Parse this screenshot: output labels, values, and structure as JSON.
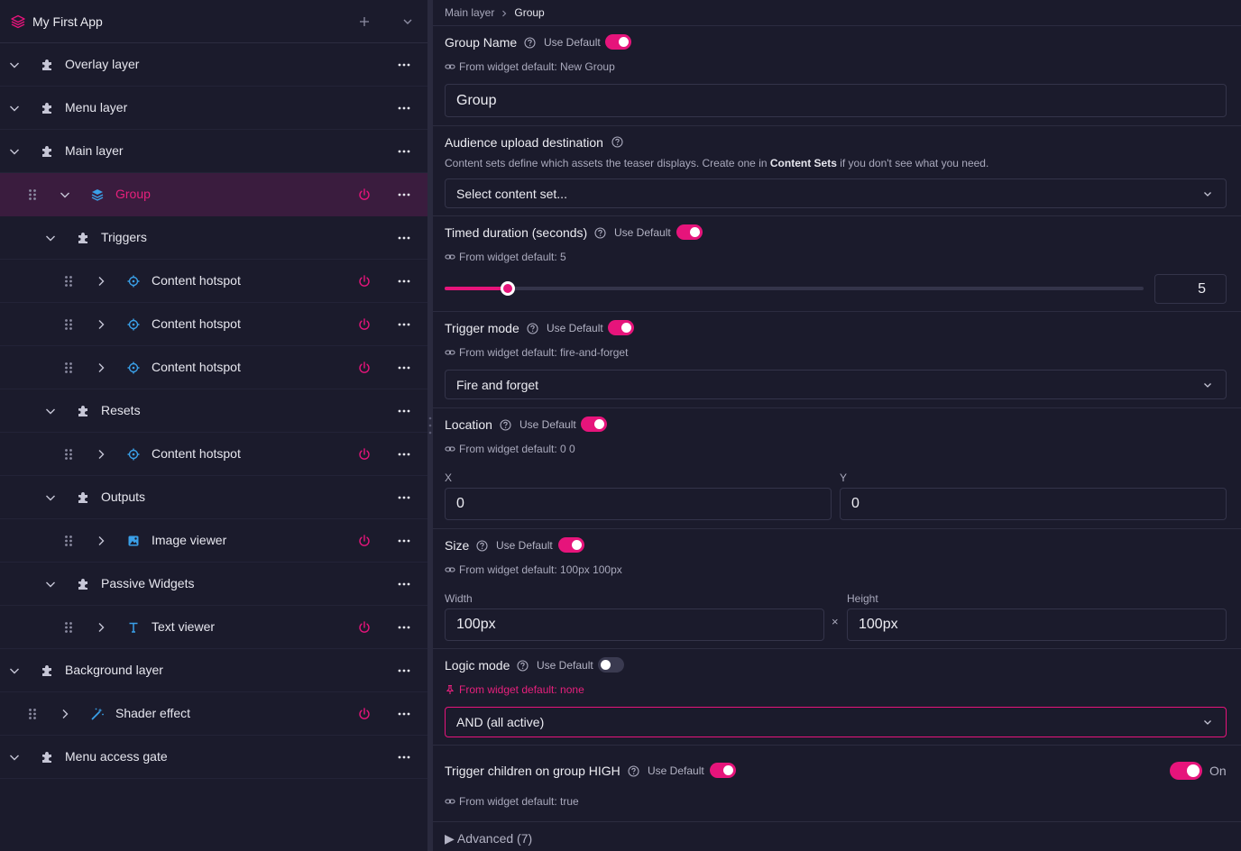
{
  "app": {
    "title": "My First App"
  },
  "tree": [
    {
      "label": "Overlay layer",
      "icon": "puzzle-icon",
      "level": 0,
      "expanded": true,
      "grip": false,
      "power": false
    },
    {
      "label": "Menu layer",
      "icon": "puzzle-icon",
      "level": 0,
      "expanded": true,
      "grip": false,
      "power": false
    },
    {
      "label": "Main layer",
      "icon": "puzzle-icon",
      "level": 0,
      "expanded": true,
      "grip": false,
      "power": false
    },
    {
      "label": "Group",
      "icon": "layers-icon",
      "level": 1,
      "expanded": true,
      "grip": true,
      "power": true,
      "selected": true
    },
    {
      "label": "Triggers",
      "icon": "puzzle-icon",
      "level": 2,
      "expanded": true,
      "grip": false,
      "power": false
    },
    {
      "label": "Content hotspot",
      "icon": "crosshair-icon",
      "level": 3,
      "expanded": false,
      "grip": true,
      "power": true
    },
    {
      "label": "Content hotspot",
      "icon": "crosshair-icon",
      "level": 3,
      "expanded": false,
      "grip": true,
      "power": true
    },
    {
      "label": "Content hotspot",
      "icon": "crosshair-icon",
      "level": 3,
      "expanded": false,
      "grip": true,
      "power": true
    },
    {
      "label": "Resets",
      "icon": "puzzle-icon",
      "level": 2,
      "expanded": true,
      "grip": false,
      "power": false
    },
    {
      "label": "Content hotspot",
      "icon": "crosshair-icon",
      "level": 3,
      "expanded": false,
      "grip": true,
      "power": true
    },
    {
      "label": "Outputs",
      "icon": "puzzle-icon",
      "level": 2,
      "expanded": true,
      "grip": false,
      "power": false
    },
    {
      "label": "Image viewer",
      "icon": "image-icon",
      "level": 3,
      "expanded": false,
      "grip": true,
      "power": true
    },
    {
      "label": "Passive Widgets",
      "icon": "puzzle-icon",
      "level": 2,
      "expanded": true,
      "grip": false,
      "power": false
    },
    {
      "label": "Text viewer",
      "icon": "text-icon",
      "level": 3,
      "expanded": false,
      "grip": true,
      "power": true
    },
    {
      "label": "Background layer",
      "icon": "puzzle-icon",
      "level": 0,
      "expanded": true,
      "grip": false,
      "power": false
    },
    {
      "label": "Shader effect",
      "icon": "magic-wand-icon",
      "level": 1,
      "expanded": false,
      "grip": true,
      "power": true
    },
    {
      "label": "Menu access gate",
      "icon": "puzzle-icon",
      "level": 0,
      "expanded": true,
      "grip": false,
      "power": false
    }
  ],
  "breadcrumb": {
    "parent": "Main layer",
    "current": "Group"
  },
  "props": {
    "use_default_label": "Use Default",
    "group_name": {
      "title": "Group Name",
      "use_default": true,
      "from_default": "From widget default: New Group",
      "value": "Group"
    },
    "audience": {
      "title": "Audience upload destination",
      "desc_before": "Content sets define which assets the teaser displays. Create one in ",
      "desc_link": "Content Sets",
      "desc_after": " if you don't see what you need.",
      "placeholder": "Select content set..."
    },
    "timed": {
      "title": "Timed duration (seconds)",
      "use_default": true,
      "from_default": "From widget default: 5",
      "value": "5",
      "slider_fraction": 0.09
    },
    "trigger_mode": {
      "title": "Trigger mode",
      "use_default": true,
      "from_default": "From widget default: fire-and-forget",
      "value": "Fire and forget"
    },
    "location": {
      "title": "Location",
      "use_default": true,
      "from_default": "From widget default: 0 0",
      "x_label": "X",
      "x_value": "0",
      "y_label": "Y",
      "y_value": "0"
    },
    "size": {
      "title": "Size",
      "use_default": true,
      "from_default": "From widget default: 100px 100px",
      "width_label": "Width",
      "width_value": "100px",
      "times": "×",
      "height_label": "Height",
      "height_value": "100px"
    },
    "logic_mode": {
      "title": "Logic mode",
      "use_default": false,
      "from_default": "From widget default: none",
      "value": "AND (all active)"
    },
    "trigger_children": {
      "title": "Trigger children on group HIGH",
      "use_default": true,
      "from_default": "From widget default: true",
      "state_label": "On"
    },
    "advanced": {
      "label": "▶ Advanced (7)"
    }
  },
  "colors": {
    "accent": "#e6147b",
    "background": "#1b1b2c",
    "selected_row": "#3a1c3e"
  }
}
